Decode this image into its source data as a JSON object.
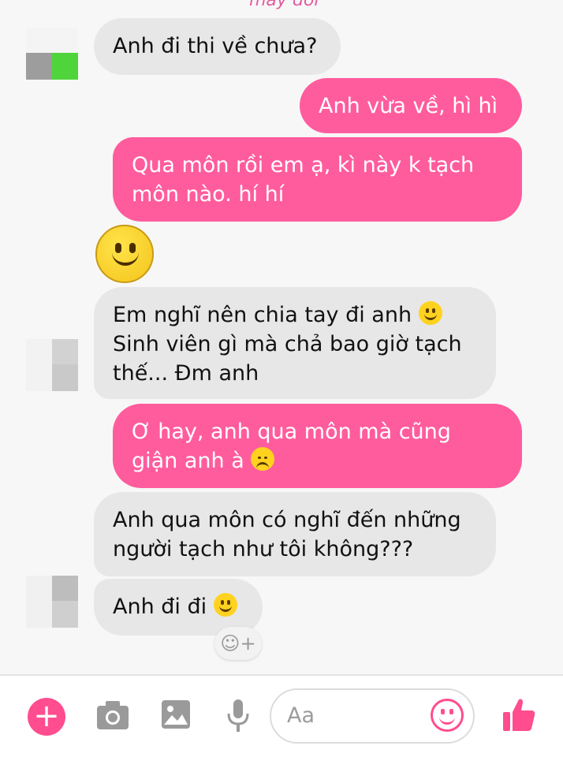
{
  "header": {
    "clipped_label": "may đơi"
  },
  "colors": {
    "outgoing_bubble": "#ff5c9d",
    "incoming_bubble": "#e7e7e7",
    "accent": "#ff4d8f"
  },
  "messages": [
    {
      "direction": "in",
      "text": "Anh đi thi về chưa?"
    },
    {
      "direction": "out",
      "text": "Anh vừa về,  hì hì"
    },
    {
      "direction": "out",
      "lines": [
        "Qua môn rồi em ạ,  kì này k tạch",
        "môn nào.  hí hí"
      ]
    },
    {
      "direction": "in",
      "lines": [
        "Em nghĩ nên chia tay đi anh",
        "Sinh viên gì mà chả bao giờ tạch",
        "thế... Đm anh"
      ],
      "emoji": "slight-smile"
    },
    {
      "direction": "out",
      "lines": [
        "Ơ hay,  anh qua môn mà cũng",
        "giận anh à"
      ],
      "emoji": "sad"
    },
    {
      "direction": "in",
      "lines": [
        "Anh qua môn có nghĩ đến những",
        "người tạch như tôi không???"
      ]
    },
    {
      "direction": "in",
      "text": "Anh đi đi",
      "emoji": "slight-smile"
    }
  ],
  "big_emoji": "smile-emoji",
  "react_button": {
    "icon": "add-reaction-icon",
    "symbol": "☺+"
  },
  "composer": {
    "placeholder": "Aa",
    "icons": [
      "plus-icon",
      "camera-icon",
      "image-icon",
      "microphone-icon",
      "emoji-icon",
      "thumbs-up-icon"
    ]
  }
}
